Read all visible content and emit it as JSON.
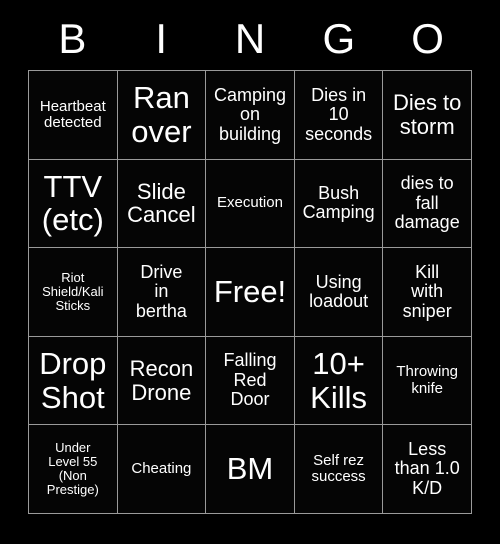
{
  "card": {
    "title": "BINGO",
    "header_letters": [
      "B",
      "I",
      "N",
      "G",
      "O"
    ],
    "free_space_label": "Free!",
    "colors": {
      "background": "#000000",
      "cell_background": "#050505",
      "grid_line": "#9a9a9a",
      "text": "#ffffff"
    },
    "rows": [
      [
        {
          "text": "Heartbeat\ndetected",
          "size": "sz-s"
        },
        {
          "text": "Ran\nover",
          "size": "sz-xxl"
        },
        {
          "text": "Camping\non\nbuilding",
          "size": "sz-m"
        },
        {
          "text": "Dies in\n10\nseconds",
          "size": "sz-m"
        },
        {
          "text": "Dies to\nstorm",
          "size": "sz-l"
        }
      ],
      [
        {
          "text": "TTV\n(etc)",
          "size": "sz-xxl"
        },
        {
          "text": "Slide\nCancel",
          "size": "sz-l"
        },
        {
          "text": "Execution",
          "size": "sz-s"
        },
        {
          "text": "Bush\nCamping",
          "size": "sz-m"
        },
        {
          "text": "dies to\nfall\ndamage",
          "size": "sz-m"
        }
      ],
      [
        {
          "text": "Riot\nShield/Kali\nSticks",
          "size": "sz-xs"
        },
        {
          "text": "Drive\nin\nbertha",
          "size": "sz-m"
        },
        {
          "text": "Free!",
          "size": "sz-xxl"
        },
        {
          "text": "Using\nloadout",
          "size": "sz-m"
        },
        {
          "text": "Kill\nwith\nsniper",
          "size": "sz-m"
        }
      ],
      [
        {
          "text": "Drop\nShot",
          "size": "sz-xxl"
        },
        {
          "text": "Recon\nDrone",
          "size": "sz-l"
        },
        {
          "text": "Falling\nRed\nDoor",
          "size": "sz-m"
        },
        {
          "text": "10+\nKills",
          "size": "sz-xxl"
        },
        {
          "text": "Throwing\nknife",
          "size": "sz-s"
        }
      ],
      [
        {
          "text": "Under\nLevel 55\n(Non\nPrestige)",
          "size": "sz-xs"
        },
        {
          "text": "Cheating",
          "size": "sz-s"
        },
        {
          "text": "BM",
          "size": "sz-xxl"
        },
        {
          "text": "Self rez\nsuccess",
          "size": "sz-s"
        },
        {
          "text": "Less\nthan 1.0\nK/D",
          "size": "sz-m"
        }
      ]
    ]
  }
}
